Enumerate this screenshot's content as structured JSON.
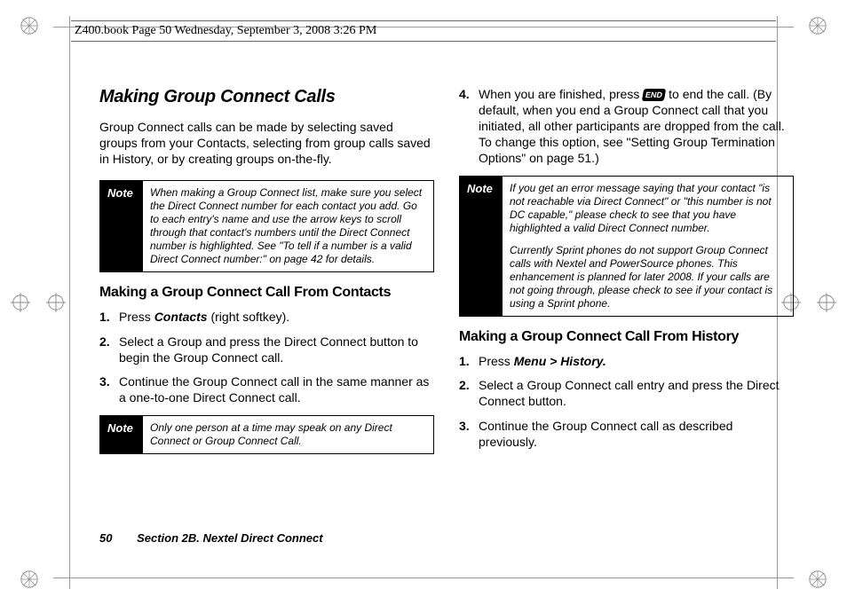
{
  "header": {
    "text": "Z400.book  Page 50  Wednesday, September 3, 2008  3:26 PM"
  },
  "left": {
    "title": "Making Group Connect Calls",
    "lead": "Group Connect calls can be made by selecting saved groups from your Contacts, selecting from group calls saved in History, or by creating groups on-the-fly.",
    "note1_label": "Note",
    "note1_body": "When making a Group Connect list, make sure you select the Direct Connect number for each contact you add. Go to each entry's name and use the arrow keys to scroll through that contact's numbers until the Direct Connect number is highlighted. See \"To tell if a number is a valid Direct Connect number:\" on page 42 for details.",
    "sub1": "Making a Group Connect Call From Contacts",
    "s1_1a": "Press ",
    "s1_1b": "Contacts",
    "s1_1c": " (right softkey).",
    "s1_2": "Select a Group and press the Direct Connect button to begin the Group Connect call.",
    "s1_3": "Continue the Group Connect call in the same manner as a one-to-one Direct Connect call.",
    "note2_label": "Note",
    "note2_body": "Only one person at a time may speak on any Direct Connect or Group Connect Call."
  },
  "right": {
    "s4_a": "When you are finished, press ",
    "s4_icon": "END",
    "s4_b": " to end the call. (By default, when you end a Group Connect call that you initiated, all other participants are dropped from the call. To change this option, see \"Setting Group Termination Options\" on page 51.)",
    "note3_label": "Note",
    "note3_body1": "If you get an error message saying that your contact \"is not reachable via Direct Connect\" or \"this number is not DC capable,\" please check to see that you have highlighted a valid Direct Connect number.",
    "note3_body2": "Currently Sprint phones do not support Group Connect calls with Nextel and PowerSource phones. This enhancement is planned for later 2008. If your calls are not going through, please check to see if your contact is using a Sprint phone.",
    "sub2": "Making a Group Connect Call From History",
    "s2_1a": "Press ",
    "s2_1b": "Menu > History.",
    "s2_2": "Select a Group Connect call entry and press the Direct Connect button.",
    "s2_3": "Continue the Group Connect call as described previously."
  },
  "footer": {
    "page": "50",
    "section": "Section 2B. Nextel Direct Connect"
  }
}
